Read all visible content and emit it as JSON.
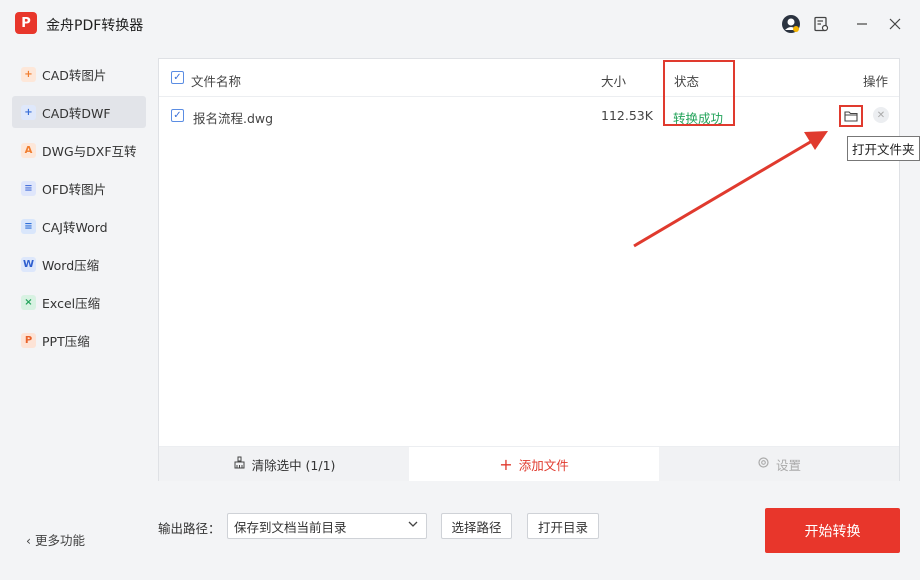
{
  "app": {
    "title": "金舟PDF转换器",
    "logo_text": "P"
  },
  "sidebar": {
    "items": [
      {
        "label": "CAD转图片",
        "icon": "cad-image-icon",
        "glyph": "+"
      },
      {
        "label": "CAD转DWF",
        "icon": "cad-dwf-icon",
        "glyph": "+"
      },
      {
        "label": "DWG与DXF互转",
        "icon": "dwg-dxf-icon",
        "glyph": "A"
      },
      {
        "label": "OFD转图片",
        "icon": "ofd-image-icon",
        "glyph": "≡"
      },
      {
        "label": "CAJ转Word",
        "icon": "caj-word-icon",
        "glyph": "≡"
      },
      {
        "label": "Word压缩",
        "icon": "word-compress-icon",
        "glyph": "W"
      },
      {
        "label": "Excel压缩",
        "icon": "excel-compress-icon",
        "glyph": "×"
      },
      {
        "label": "PPT压缩",
        "icon": "ppt-compress-icon",
        "glyph": "P"
      }
    ],
    "active_index": 1,
    "more_label": "更多功能"
  },
  "table": {
    "headers": {
      "name": "文件名称",
      "size": "大小",
      "status": "状态",
      "action": "操作"
    },
    "rows": [
      {
        "name": "报名流程.dwg",
        "size": "112.53K",
        "status": "转换成功",
        "checked": true
      }
    ],
    "tooltip": "打开文件夹"
  },
  "panel_toolbar": {
    "clear_label": "清除选中 (1/1)",
    "add_label": "添加文件",
    "settings_label": "设置"
  },
  "output": {
    "label": "输出路径：",
    "select_value": "保存到文档当前目录",
    "choose_path_label": "选择路径",
    "open_dir_label": "打开目录"
  },
  "start_button": "开始转换",
  "colors": {
    "accent": "#e8362b",
    "success": "#23a35a",
    "annotation": "#e03a2e"
  }
}
